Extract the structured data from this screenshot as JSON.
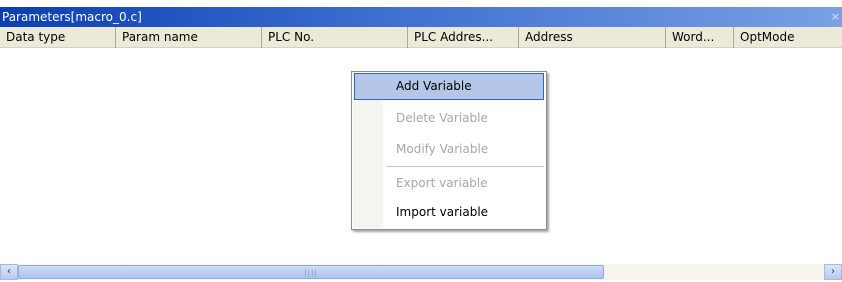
{
  "window": {
    "title": "Parameters[macro_0.c]",
    "close_glyph": "×"
  },
  "table": {
    "columns": [
      "Data type",
      "Param name",
      "PLC No.",
      "PLC Addres...",
      "Address",
      "Word...",
      "OptMode"
    ]
  },
  "context_menu": {
    "items": [
      {
        "label": "Add Variable",
        "enabled": true,
        "selected": true
      },
      {
        "label": "Delete Variable",
        "enabled": false,
        "selected": false
      },
      {
        "label": "Modify Variable",
        "enabled": false,
        "selected": false
      },
      {
        "label": "Export variable",
        "enabled": false,
        "selected": false
      },
      {
        "label": "Import variable",
        "enabled": true,
        "selected": false
      }
    ]
  },
  "scrollbar": {
    "left_arrow": "‹",
    "right_arrow": "›",
    "grip": "||||"
  }
}
